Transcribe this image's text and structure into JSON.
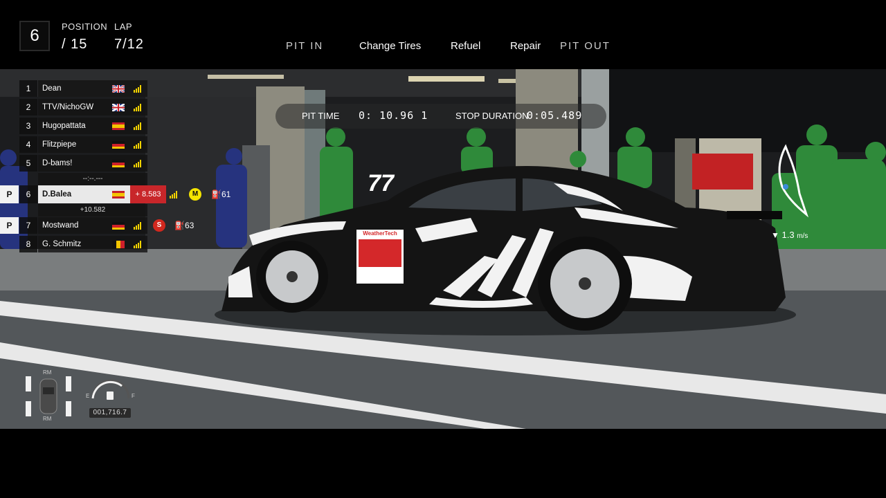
{
  "hud": {
    "position_current": "6",
    "position_label": "POSITION",
    "position_total": "/ 15",
    "lap_label": "LAP",
    "lap_value": "7/12"
  },
  "pit_menu": {
    "pit_in": "PIT IN",
    "change_tires": "Change Tires",
    "refuel": "Refuel",
    "repair": "Repair",
    "pit_out": "PIT OUT"
  },
  "pit_timer": {
    "pit_time_label": "PIT TIME",
    "pit_time_value": "0: 10.96 1",
    "stop_duration_label": "STOP DURATION",
    "stop_duration_value": "0:05.489"
  },
  "leaderboard": {
    "rows": [
      {
        "pos": "1",
        "name": "Dean",
        "flag": "gb"
      },
      {
        "pos": "2",
        "name": "TTV/NichoGW",
        "flag": "gb"
      },
      {
        "pos": "3",
        "name": "Hugopattata",
        "flag": "es"
      },
      {
        "pos": "4",
        "name": "Flitzpiepe",
        "flag": "de"
      },
      {
        "pos": "5",
        "name": "D-bams!",
        "flag": "de"
      },
      {
        "pos": "6",
        "name": "D.Balea",
        "flag": "es",
        "pit_badge": "P",
        "gap": "+ 8.583",
        "tyre": "M",
        "fuel": "61"
      },
      {
        "pos": "7",
        "name": "Mostwand",
        "flag": "de",
        "pit_badge": "P",
        "tyre": "S",
        "fuel": "63"
      },
      {
        "pos": "8",
        "name": "G. Schmitz",
        "flag": "be"
      }
    ],
    "gap_above": "--:--.---",
    "gap_below": "+10.582"
  },
  "telemetry": {
    "speed_value": "1.3",
    "speed_unit": "m/s",
    "odometer": "001,716.7",
    "tire_front_label": "RM",
    "tire_rear_label": "RM",
    "fuel_empty": "E",
    "fuel_full": "F"
  },
  "car": {
    "number": "77",
    "sponsor": "WeatherTech"
  },
  "colors": {
    "gap_red": "#c8262a",
    "signal_yellow": "#f4d400",
    "crew_green": "#2f8a3a",
    "tyre_medium": "#f4e400",
    "tyre_soft": "#d2281e"
  }
}
